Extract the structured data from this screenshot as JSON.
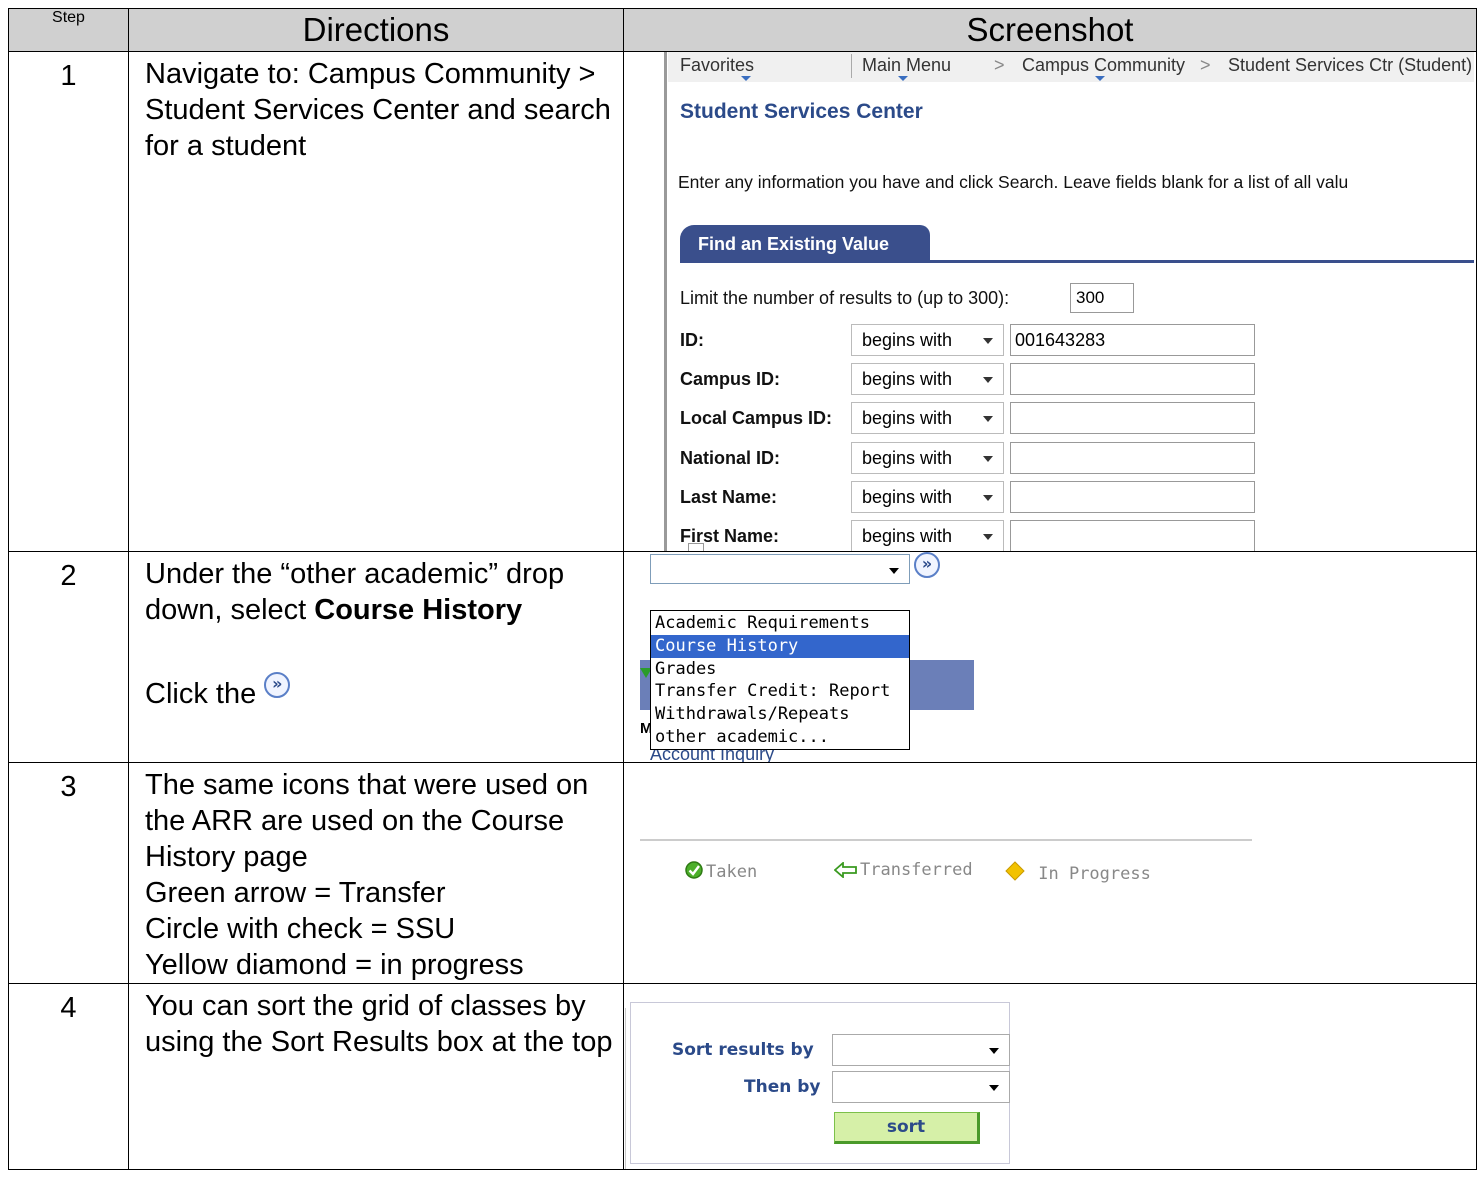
{
  "headers": {
    "step": "Step",
    "directions": "Directions",
    "screenshot": "Screenshot"
  },
  "rows": [
    {
      "step": "1",
      "directions": "Navigate to: Campus Community > Student Services Center and search for a student"
    },
    {
      "step": "2",
      "dir_prefix": "Under the “other academic” drop down, select ",
      "dir_bold": "Course History",
      "dir_click": "Click the "
    },
    {
      "step": "3",
      "lines": [
        "The same icons that were used on the ARR are used on the Course History page",
        "Green arrow = Transfer",
        "Circle with check = SSU",
        "Yellow diamond = in progress"
      ]
    },
    {
      "step": "4",
      "directions": "You can sort the grid of classes by using the Sort Results box at the top"
    }
  ],
  "ps_search": {
    "nav": {
      "favorites": "Favorites",
      "main_menu": "Main Menu",
      "sep": ">",
      "campus_community": "Campus Community",
      "ssc_student": "Student Services Ctr (Student)"
    },
    "title": "Student Services Center",
    "instructions": "Enter any information you have and click Search. Leave fields blank for a list of all valu",
    "tab": "Find an Existing Value",
    "limit_label": "Limit the number of results to (up to 300):",
    "limit_value": "300",
    "operator": "begins with",
    "fields": [
      {
        "label": "ID:",
        "value": "001643283"
      },
      {
        "label": "Campus ID:",
        "value": ""
      },
      {
        "label": "Local Campus ID:",
        "value": ""
      },
      {
        "label": "National ID:",
        "value": ""
      },
      {
        "label": "Last Name:",
        "value": ""
      },
      {
        "label": "First Name:",
        "value": ""
      }
    ]
  },
  "dropdown": {
    "go_glyph": "»",
    "options": [
      "Academic Requirements",
      "Course History",
      "Grades",
      "Transfer Credit: Report",
      "Withdrawals/Repeats",
      "other academic..."
    ],
    "selected": "Course History",
    "behind_letter": "M",
    "behind_link": "Account Inquiry"
  },
  "legend": {
    "taken": "Taken",
    "transferred": "Transferred",
    "in_progress": "In Progress",
    "colors": {
      "taken": "#4caf2a",
      "transferred": "#4caf2a",
      "in_progress": "#f2c200"
    }
  },
  "sort_box": {
    "sort_label": "Sort results by",
    "then_label": "Then by",
    "button": "sort"
  }
}
